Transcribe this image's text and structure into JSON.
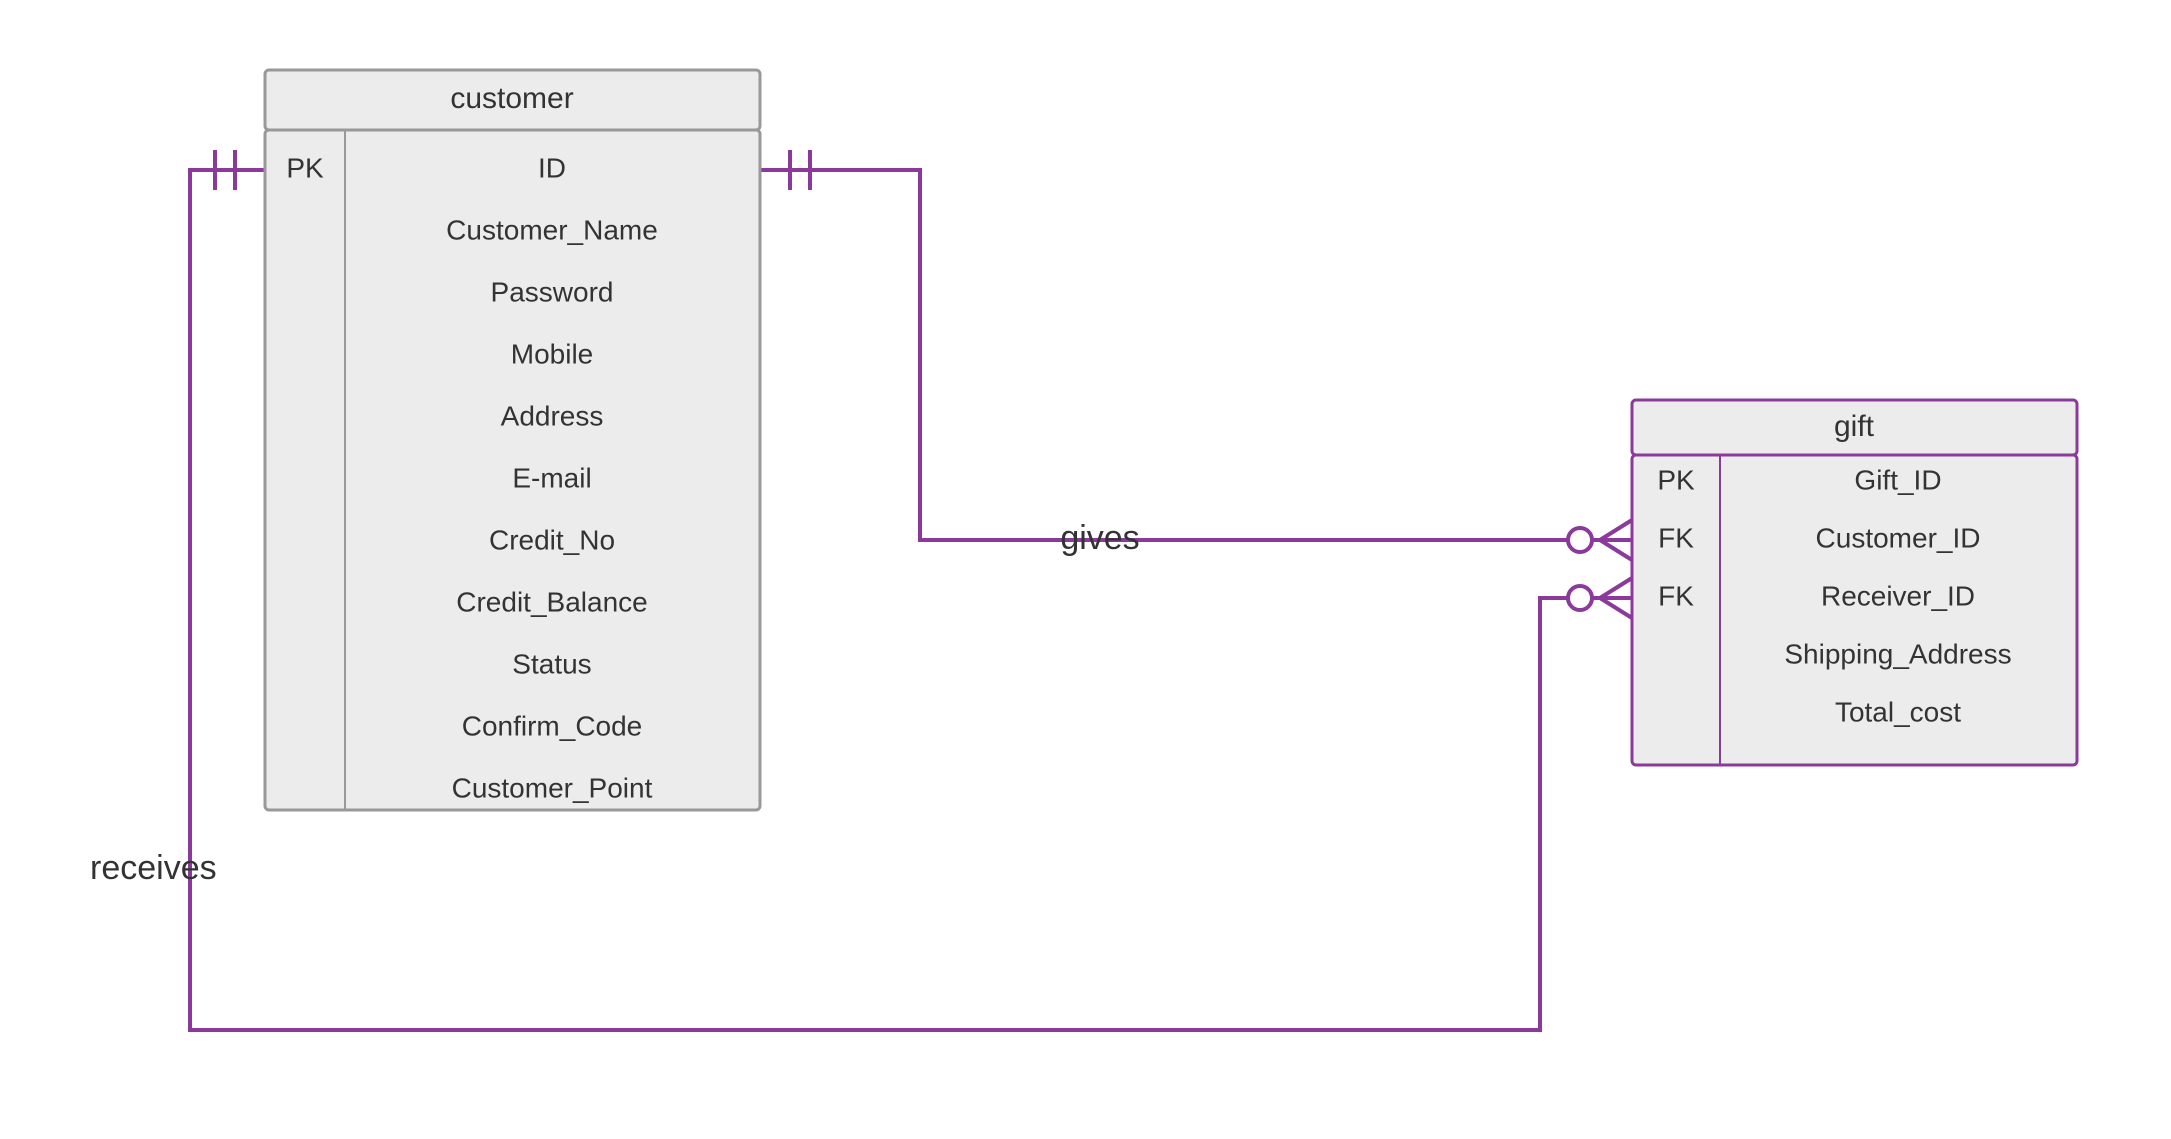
{
  "entities": {
    "customer": {
      "title": "customer",
      "attributes": [
        {
          "key": "PK",
          "name": "ID"
        },
        {
          "key": "",
          "name": "Customer_Name"
        },
        {
          "key": "",
          "name": "Password"
        },
        {
          "key": "",
          "name": "Mobile"
        },
        {
          "key": "",
          "name": "Address"
        },
        {
          "key": "",
          "name": "E-mail"
        },
        {
          "key": "",
          "name": "Credit_No"
        },
        {
          "key": "",
          "name": "Credit_Balance"
        },
        {
          "key": "",
          "name": "Status"
        },
        {
          "key": "",
          "name": "Confirm_Code"
        },
        {
          "key": "",
          "name": "Customer_Point"
        }
      ]
    },
    "gift": {
      "title": "gift",
      "attributes": [
        {
          "key": "PK",
          "name": "Gift_ID"
        },
        {
          "key": "FK",
          "name": "Customer_ID"
        },
        {
          "key": "FK",
          "name": "Receiver_ID"
        },
        {
          "key": "",
          "name": "Shipping_Address"
        },
        {
          "key": "",
          "name": "Total_cost"
        }
      ]
    }
  },
  "relationships": {
    "gives": {
      "label": "gives"
    },
    "receives": {
      "label": "receives"
    }
  }
}
